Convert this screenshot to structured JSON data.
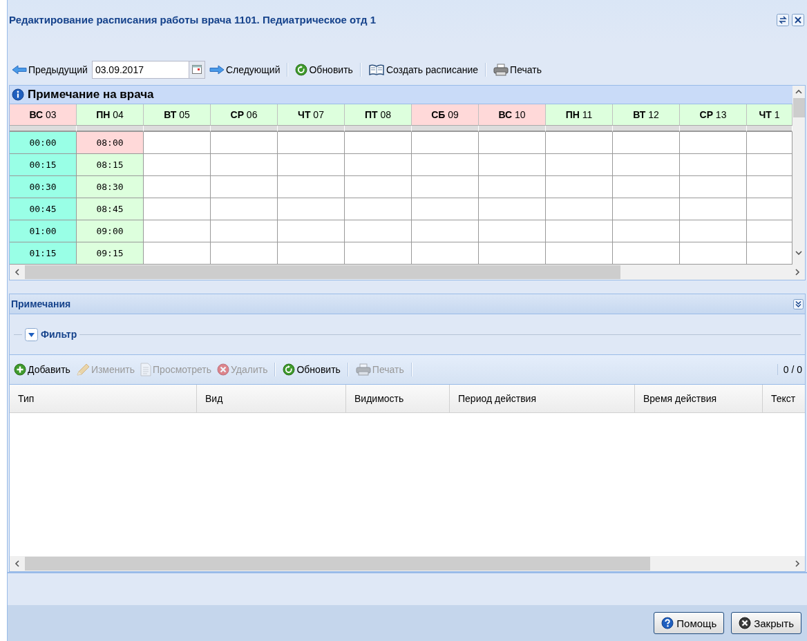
{
  "window": {
    "title": "Редактирование расписания работы врача",
    "department": "1101. Педиатрическое отд 1"
  },
  "toolbar": {
    "items": [
      {
        "kind": "prev",
        "label": "Предыдущий"
      },
      {
        "kind": "date",
        "value": "03.09.2017"
      },
      {
        "kind": "next",
        "label": "Следующий"
      },
      {
        "kind": "separator"
      },
      {
        "kind": "refresh",
        "label": "Обновить"
      },
      {
        "kind": "separator"
      },
      {
        "kind": "book",
        "label": "Создать расписание"
      },
      {
        "kind": "separator"
      },
      {
        "kind": "print",
        "label": "Печать"
      }
    ]
  },
  "schedule": {
    "note_title": "Примечание на врача",
    "days": [
      {
        "label": "**ВС** 03",
        "color": "#ffd9d9",
        "slots": [
          {
            "text": "00:00",
            "color": "#99ffe6"
          },
          {
            "text": "00:15",
            "color": "#99ffe6"
          },
          {
            "text": "00:30",
            "color": "#99ffe6"
          },
          {
            "text": "00:45",
            "color": "#99ffe6"
          },
          {
            "text": "01:00",
            "color": "#99ffe6"
          },
          {
            "text": "01:15",
            "color": "#99ffe6"
          }
        ]
      },
      {
        "label": "**ПН** 04",
        "color": "#ddffdd",
        "slots": [
          {
            "text": "08:00",
            "color": "#ffd9d9"
          },
          {
            "text": "08:15",
            "color": "#ddffdd"
          },
          {
            "text": "08:30",
            "color": "#ddffdd"
          },
          {
            "text": "08:45",
            "color": "#ddffdd"
          },
          {
            "text": "09:00",
            "color": "#ddffdd"
          },
          {
            "text": "09:15",
            "color": "#ddffdd"
          }
        ]
      },
      {
        "label": "**ВТ** 05",
        "color": "#ddffdd"
      },
      {
        "label": "**СР** 06",
        "color": "#ddffdd"
      },
      {
        "label": "**ЧТ** 07",
        "color": "#ddffdd"
      },
      {
        "label": "**ПТ** 08",
        "color": "#ddffdd"
      },
      {
        "label": "**СБ** 09",
        "color": "#ffd9d9"
      },
      {
        "label": "**ВС** 10",
        "color": "#ffd9d9"
      },
      {
        "label": "**ПН** 11",
        "color": "#ddffdd"
      },
      {
        "label": "**ВТ** 12",
        "color": "#ddffdd"
      },
      {
        "label": "**СР** 13",
        "color": "#ddffdd"
      },
      {
        "label": "**ЧТ** 1",
        "color": "#ddffdd"
      }
    ]
  },
  "notes": {
    "title": "Примечания",
    "filter": {
      "label": "Фильтр",
      "expanded": false
    },
    "toolbar": {
      "items": [
        {
          "kind": "add",
          "label": "Добавить",
          "disabled": false
        },
        {
          "kind": "edit",
          "label": "Изменить",
          "disabled": true
        },
        {
          "kind": "view",
          "label": "Просмотреть",
          "disabled": true
        },
        {
          "kind": "delete",
          "label": "Удалить",
          "disabled": true
        },
        {
          "kind": "separator"
        },
        {
          "kind": "refresh",
          "label": "Обновить",
          "disabled": false
        },
        {
          "kind": "separator"
        },
        {
          "kind": "print",
          "label": "Печать",
          "disabled": true
        },
        {
          "kind": "separator"
        }
      ],
      "pager": "0 / 0"
    },
    "columns": [
      "Тип",
      "Вид",
      "Видимость",
      "Период действия",
      "Время действия",
      "Текст"
    ]
  },
  "footer": {
    "buttons": [
      {
        "kind": "help",
        "label": "Помощь"
      },
      {
        "kind": "close",
        "label": "Закрыть"
      }
    ]
  }
}
